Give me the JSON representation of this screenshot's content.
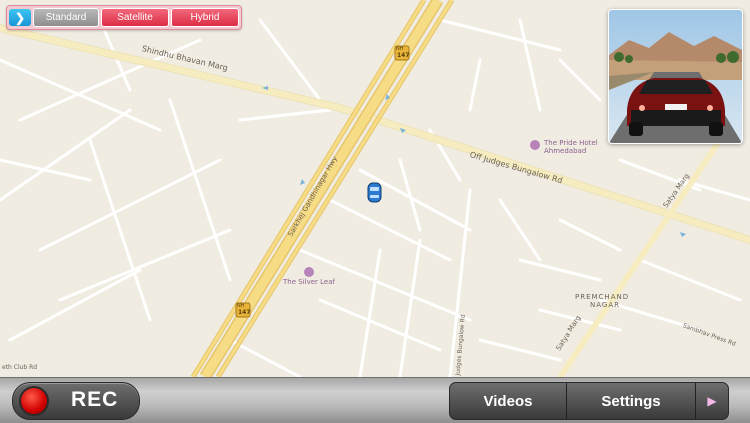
{
  "map": {
    "labels": {
      "shindu_bhavan_marg": "Shindhu Bhavan Marg",
      "sarkhej_gandhinagar_hwy": "Sarkhej Gandhinagar Hwy",
      "off_judges_bungalow_rd": "Off Judges Bungalow Rd",
      "satya_marg_upper": "Satya Marg",
      "satya_marg_lower": "Satya Marg",
      "premchand_nagar_1": "PREMCHAND",
      "premchand_nagar_2": "NAGAR",
      "sambhav_press_rd": "Sambhav Press Rd",
      "judges_bungalow_rd": "Judges Bungalow Rd",
      "club_rd": "eth Club Rd",
      "nh_shield_top": "147",
      "nh_shield_bottom": "147",
      "nh_prefix": "NH"
    },
    "pois": {
      "pride_hotel_line1": "The Pride Hotel",
      "pride_hotel_line2": "Ahmedabad",
      "silver_leaf": "The Silver Leaf"
    }
  },
  "map_types": {
    "standard": "Standard",
    "satellite": "Satellite",
    "hybrid": "Hybrid",
    "selected": "Standard"
  },
  "bottom_bar": {
    "rec_label": "REC",
    "videos_label": "Videos",
    "settings_label": "Settings"
  },
  "icons": {
    "toggle": "chevron-right-icon",
    "play": "play-icon",
    "record": "record-dot-icon",
    "car_marker": "car-marker-icon"
  },
  "colors": {
    "road_major": "#f6d87a",
    "road_arterial": "#f2e6a9",
    "rec_red": "#d10000",
    "segment_red": "#dc2d45"
  }
}
